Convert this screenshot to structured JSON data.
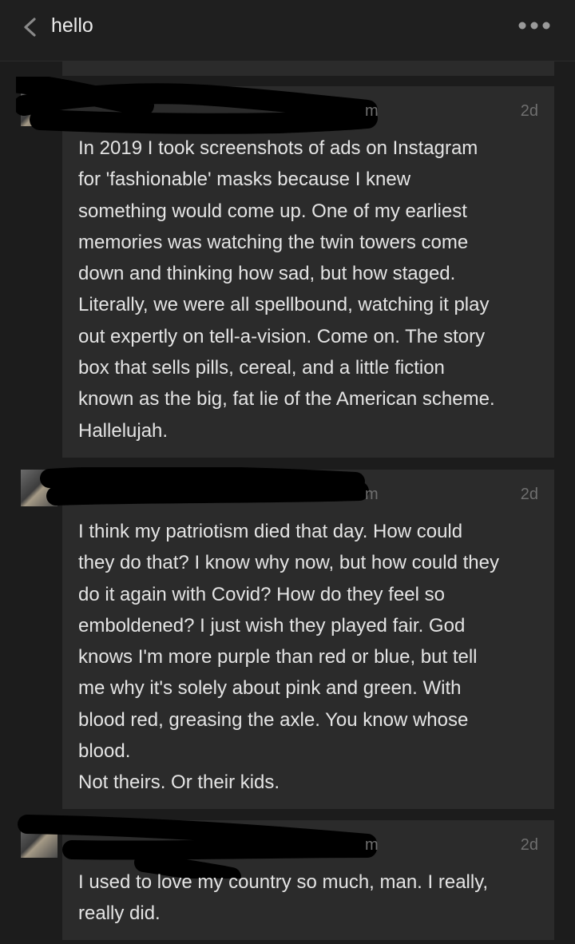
{
  "header": {
    "title": "hello",
    "back_icon": "chevron-left-icon",
    "more_icon": "more-horizontal-icon"
  },
  "comments": [
    {
      "name_visible_fragment": "m",
      "time": "2d",
      "text": "In 2019 I took screenshots of ads on Instagram\nfor 'fashionable' masks because I knew\nsomething would come up. One of my earliest\nmemories was watching the twin towers come\ndown and thinking how sad, but how staged.\nLiterally, we were all spellbound, watching it play\nout expertly on tell-a-vision. Come on. The story\nbox that sells pills, cereal, and a little fiction\nknown as the big, fat lie of the American scheme.\nHallelujah."
    },
    {
      "name_visible_fragment": "m",
      "time": "2d",
      "text": "I think my patriotism died that day. How could\nthey do that? I know why now, but how could they\ndo it again with Covid? How do they feel so\nemboldened? I just wish they played fair. God\nknows I'm more purple than red or blue, but tell\nme why it's solely about pink and green. With\nblood red, greasing the axle. You know whose\nblood.\nNot theirs. Or their kids."
    },
    {
      "name_visible_fragment": "m",
      "time": "2d",
      "text": "I used to love my country so much, man. I really,\nreally did."
    }
  ]
}
